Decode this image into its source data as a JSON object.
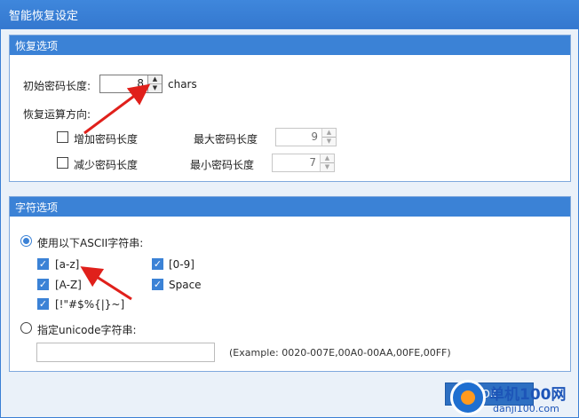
{
  "window": {
    "title": "智能恢复设定"
  },
  "recovery": {
    "group_title": "恢复选项",
    "initial_len_label": "初始密码长度:",
    "initial_len_value": "8",
    "chars_label": "chars",
    "direction_label": "恢复运算方向:",
    "increase_label": "增加密码长度",
    "decrease_label": "减少密码长度",
    "max_label": "最大密码长度",
    "max_value": "9",
    "min_label": "最小密码长度",
    "min_value": "7"
  },
  "charset": {
    "group_title": "字符选项",
    "ascii_radio_label": "使用以下ASCII字符串:",
    "items": [
      {
        "label": "[a-z]",
        "checked": true
      },
      {
        "label": "[0-9]",
        "checked": true
      },
      {
        "label": "[A-Z]",
        "checked": true
      },
      {
        "label": "Space",
        "checked": true
      },
      {
        "label": "[!\"#$%{|}~]",
        "checked": true
      }
    ],
    "unicode_radio_label": "指定unicode字符串:",
    "unicode_value": "",
    "example_text": "(Example: 0020-007E,00A0-00AA,00FE,00FF)"
  },
  "buttons": {
    "ok_label": "OK"
  },
  "watermark": {
    "line1": "单机100网",
    "line2": "danji100.com"
  },
  "colors": {
    "accent": "#3b82d6",
    "annotation_arrow": "#e0201b"
  }
}
